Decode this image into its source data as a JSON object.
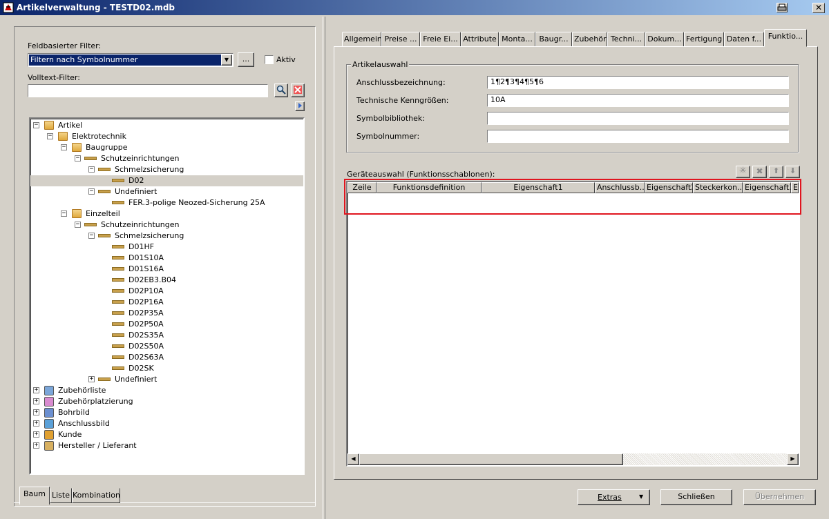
{
  "window": {
    "title": "Artikelverwaltung - TESTD02.mdb",
    "close_label": "✕"
  },
  "left": {
    "filter_label": "Feldbasierter Filter:",
    "filter_select": "Filtern nach Symbolnummer",
    "ellipsis_label": "...",
    "aktiv_label": "Aktiv",
    "volltext_label": "Volltext-Filter:",
    "volltext_value": "",
    "tree": [
      {
        "label": "Artikel",
        "icon": "folder-icon",
        "expander": "−"
      },
      {
        "label": "Elektrotechnik",
        "icon": "folder-icon",
        "expander": "−"
      },
      {
        "label": "Baugruppe",
        "icon": "folder-icon",
        "expander": "−"
      },
      {
        "label": "Schutzeinrichtungen",
        "icon": "plug-icon",
        "expander": "−"
      },
      {
        "label": "Schmelzsicherung",
        "icon": "plug-icon",
        "expander": "−"
      },
      {
        "label": "D02",
        "icon": "plug-icon",
        "expander": ""
      },
      {
        "label": "Undefiniert",
        "icon": "plug-icon",
        "expander": "−"
      },
      {
        "label": "FER.3-polige Neozed-Sicherung 25A",
        "icon": "plug-icon",
        "expander": ""
      },
      {
        "label": "Einzelteil",
        "icon": "folder-icon",
        "expander": "−"
      },
      {
        "label": "Schutzeinrichtungen",
        "icon": "plug-icon",
        "expander": "−"
      },
      {
        "label": "Schmelzsicherung",
        "icon": "plug-icon",
        "expander": "−"
      },
      {
        "label": "D01HF",
        "icon": "plug-icon",
        "expander": ""
      },
      {
        "label": "D01S10A",
        "icon": "plug-icon",
        "expander": ""
      },
      {
        "label": "D01S16A",
        "icon": "plug-icon",
        "expander": ""
      },
      {
        "label": "D02EB3.B04",
        "icon": "plug-icon",
        "expander": ""
      },
      {
        "label": "D02P10A",
        "icon": "plug-icon",
        "expander": ""
      },
      {
        "label": "D02P16A",
        "icon": "plug-icon",
        "expander": ""
      },
      {
        "label": "D02P35A",
        "icon": "plug-icon",
        "expander": ""
      },
      {
        "label": "D02P50A",
        "icon": "plug-icon",
        "expander": ""
      },
      {
        "label": "D02S35A",
        "icon": "plug-icon",
        "expander": ""
      },
      {
        "label": "D02S50A",
        "icon": "plug-icon",
        "expander": ""
      },
      {
        "label": "D02S63A",
        "icon": "plug-icon",
        "expander": ""
      },
      {
        "label": "D02SK",
        "icon": "plug-icon",
        "expander": ""
      },
      {
        "label": "Undefiniert",
        "icon": "plug-icon",
        "expander": "+"
      },
      {
        "label": "Zubehörliste",
        "icon": "list-icon",
        "expander": "+"
      },
      {
        "label": "Zubehörplatzierung",
        "icon": "placement-icon",
        "expander": "+"
      },
      {
        "label": "Bohrbild",
        "icon": "drill-icon",
        "expander": "+"
      },
      {
        "label": "Anschlussbild",
        "icon": "connection-icon",
        "expander": "+"
      },
      {
        "label": "Kunde",
        "icon": "customer-icon",
        "expander": "+"
      },
      {
        "label": "Hersteller / Lieferant",
        "icon": "factory-icon",
        "expander": "+"
      }
    ],
    "bottom_tabs": [
      "Baum",
      "Liste",
      "Kombination"
    ]
  },
  "right": {
    "tabs": [
      "Allgemein",
      "Preise ...",
      "Freie Ei...",
      "Attribute",
      "Monta...",
      "Baugr...",
      "Zubehör",
      "Techni...",
      "Dokum...",
      "Fertigung",
      "Daten f...",
      "Funktio..."
    ],
    "group_title": "Artikelauswahl",
    "fields": [
      {
        "label": "Anschlussbezeichnung:",
        "value": "1¶2¶3¶4¶5¶6"
      },
      {
        "label": "Technische Kenngrößen:",
        "value": "10A"
      },
      {
        "label": "Symbolbibliothek:",
        "value": ""
      },
      {
        "label": "Symbolnummer:",
        "value": ""
      }
    ],
    "geraete_label": "Geräteauswahl (Funktionsschablonen):",
    "columns": [
      "Zeile",
      "Funktionsdefinition",
      "Eigenschaft1",
      "Anschlussb...",
      "Eigenschaft2",
      "Steckerkon...",
      "Eigenschaft3",
      "E"
    ]
  },
  "footer": {
    "extras": "Extras",
    "schliessen": "Schließen",
    "uebernehmen": "Übernehmen"
  },
  "colors": {
    "highlight_border": "#e0141e",
    "titlebar": "#0a246a"
  }
}
